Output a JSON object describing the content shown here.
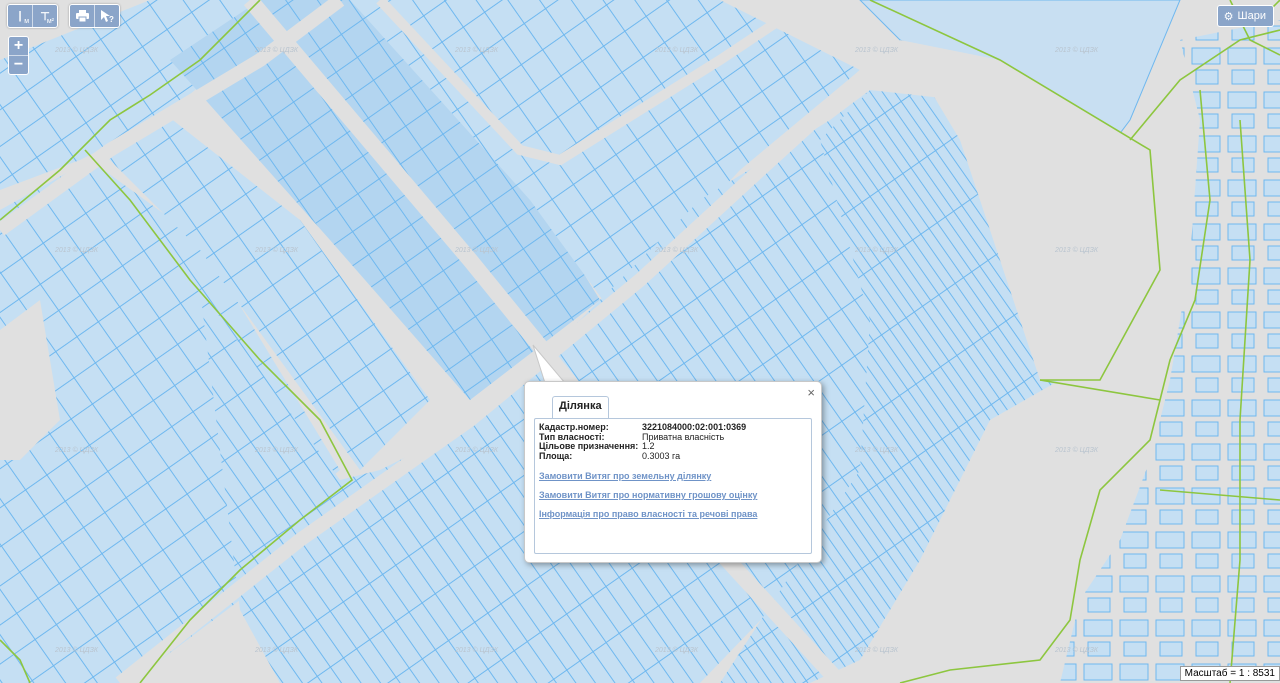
{
  "toolbar": {
    "measure_length": {
      "icon": "ruler-length-icon",
      "unit": "м"
    },
    "measure_area": {
      "icon": "ruler-area-icon",
      "unit": "м²"
    },
    "print": {
      "icon": "printer-icon"
    },
    "identify": {
      "icon": "identify-cursor-icon"
    }
  },
  "zoom": {
    "in_label": "+",
    "out_label": "−"
  },
  "layers_button": {
    "icon": "gear-icon",
    "label": "Шари"
  },
  "watermark": "2013 © ЦДЗК",
  "popup": {
    "tab_label": "Ділянка",
    "close_label": "×",
    "fields": [
      {
        "key": "Кадастр.номер:",
        "value": "3221084000:02:001:0369"
      },
      {
        "key": "Тип власності:",
        "value": "Приватна власність"
      },
      {
        "key": "Цільове призначення:",
        "value": "1.2"
      },
      {
        "key": "Площа:",
        "value": "0.3003 га"
      }
    ],
    "links": [
      "Замовити Витяг про земельну ділянку",
      "Замовити Витяг про нормативну грошову оцінку",
      "Інформація про право власності та речові права"
    ]
  },
  "scale_label": "Масштаб = 1 : 8531",
  "colors": {
    "background": "#e0e0e0",
    "parcel_fill": "#c5dff3",
    "parcel_stroke": "#6fb8ef",
    "boundary": "#8dc63f",
    "button": "#8ba5c9"
  }
}
